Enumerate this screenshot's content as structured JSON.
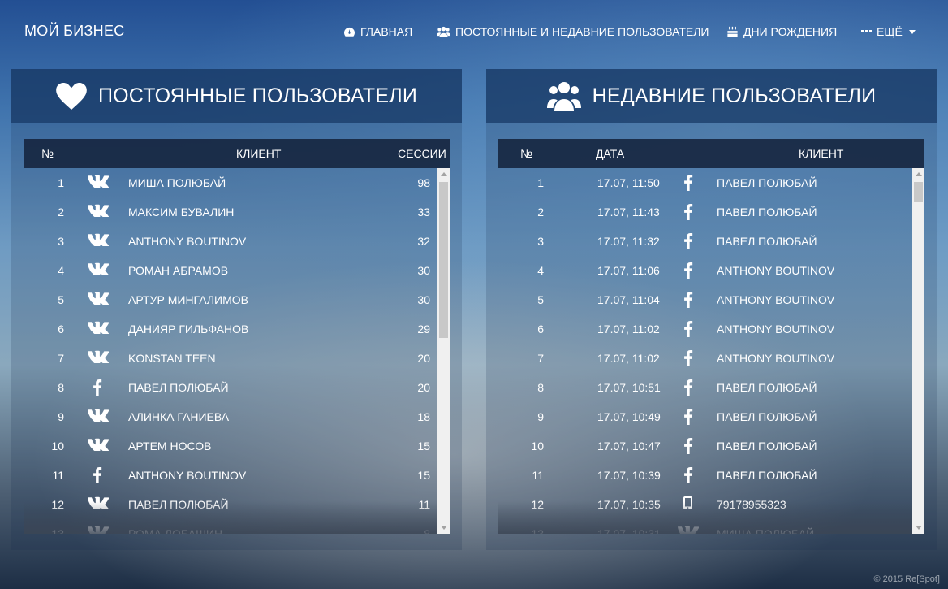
{
  "nav": {
    "brand": "МОЙ БИЗНЕС",
    "items": [
      {
        "label": "ГЛАВНАЯ",
        "icon": "dashboard-icon"
      },
      {
        "label": "ПОСТОЯННЫЕ И НЕДАВНИЕ ПОЛЬЗОВАТЕЛИ",
        "icon": "users-icon"
      },
      {
        "label": "ДНИ РОЖДЕНИЯ",
        "icon": "cake-icon"
      },
      {
        "label": "ЕЩЁ",
        "icon": "ellipsis-icon"
      }
    ]
  },
  "regular": {
    "title": "ПОСТОЯННЫЕ ПОЛЬЗОВАТЕЛИ",
    "icon": "heart-icon",
    "columns": {
      "num": "№",
      "client": "КЛИЕНТ",
      "sessions": "СЕССИИ"
    },
    "rows": [
      {
        "num": "1",
        "source": "vk",
        "name": "МИША ПОЛЮБАЙ",
        "sessions": "98"
      },
      {
        "num": "2",
        "source": "vk",
        "name": "МАКСИМ БУВАЛИН",
        "sessions": "33"
      },
      {
        "num": "3",
        "source": "vk",
        "name": "ANTHONY BOUTINOV",
        "sessions": "32"
      },
      {
        "num": "4",
        "source": "vk",
        "name": "РОМАН АБРАМОВ",
        "sessions": "30"
      },
      {
        "num": "5",
        "source": "vk",
        "name": "АРТУР МИНГАЛИМОВ",
        "sessions": "30"
      },
      {
        "num": "6",
        "source": "vk",
        "name": "ДАНИЯР ГИЛЬФАНОВ",
        "sessions": "29"
      },
      {
        "num": "7",
        "source": "vk",
        "name": "KONSTAN TEEN",
        "sessions": "20"
      },
      {
        "num": "8",
        "source": "fb",
        "name": "ПАВЕЛ ПОЛЮБАЙ",
        "sessions": "20"
      },
      {
        "num": "9",
        "source": "vk",
        "name": "АЛИНКА ГАНИЕВА",
        "sessions": "18"
      },
      {
        "num": "10",
        "source": "vk",
        "name": "АРТЕМ НОСОВ",
        "sessions": "15"
      },
      {
        "num": "11",
        "source": "fb",
        "name": "ANTHONY BOUTINOV",
        "sessions": "15"
      },
      {
        "num": "12",
        "source": "vk",
        "name": "ПАВЕЛ ПОЛЮБАЙ",
        "sessions": "11"
      },
      {
        "num": "13",
        "source": "vk",
        "name": "РОМА ЛОБАШИН",
        "sessions": "8"
      }
    ]
  },
  "recent": {
    "title": "НЕДАВНИЕ ПОЛЬЗОВАТЕЛИ",
    "icon": "group-icon",
    "columns": {
      "num": "№",
      "date": "ДАТА",
      "client": "КЛИЕНТ"
    },
    "rows": [
      {
        "num": "1",
        "date": "17.07, 11:50",
        "source": "fb",
        "name": "ПАВЕЛ ПОЛЮБАЙ"
      },
      {
        "num": "2",
        "date": "17.07, 11:43",
        "source": "fb",
        "name": "ПАВЕЛ ПОЛЮБАЙ"
      },
      {
        "num": "3",
        "date": "17.07, 11:32",
        "source": "fb",
        "name": "ПАВЕЛ ПОЛЮБАЙ"
      },
      {
        "num": "4",
        "date": "17.07, 11:06",
        "source": "fb",
        "name": "ANTHONY BOUTINOV"
      },
      {
        "num": "5",
        "date": "17.07, 11:04",
        "source": "fb",
        "name": "ANTHONY BOUTINOV"
      },
      {
        "num": "6",
        "date": "17.07, 11:02",
        "source": "fb",
        "name": "ANTHONY BOUTINOV"
      },
      {
        "num": "7",
        "date": "17.07, 11:02",
        "source": "fb",
        "name": "ANTHONY BOUTINOV"
      },
      {
        "num": "8",
        "date": "17.07, 10:51",
        "source": "fb",
        "name": "ПАВЕЛ ПОЛЮБАЙ"
      },
      {
        "num": "9",
        "date": "17.07, 10:49",
        "source": "fb",
        "name": "ПАВЕЛ ПОЛЮБАЙ"
      },
      {
        "num": "10",
        "date": "17.07, 10:47",
        "source": "fb",
        "name": "ПАВЕЛ ПОЛЮБАЙ"
      },
      {
        "num": "11",
        "date": "17.07, 10:39",
        "source": "fb",
        "name": "ПАВЕЛ ПОЛЮБАЙ"
      },
      {
        "num": "12",
        "date": "17.07, 10:35",
        "source": "phone",
        "name": "79178955323"
      },
      {
        "num": "13",
        "date": "17.07, 10:31",
        "source": "vk",
        "name": "МИША ПОЛЮБАЙ"
      }
    ]
  },
  "footer": "© 2015 Re[Spot]"
}
